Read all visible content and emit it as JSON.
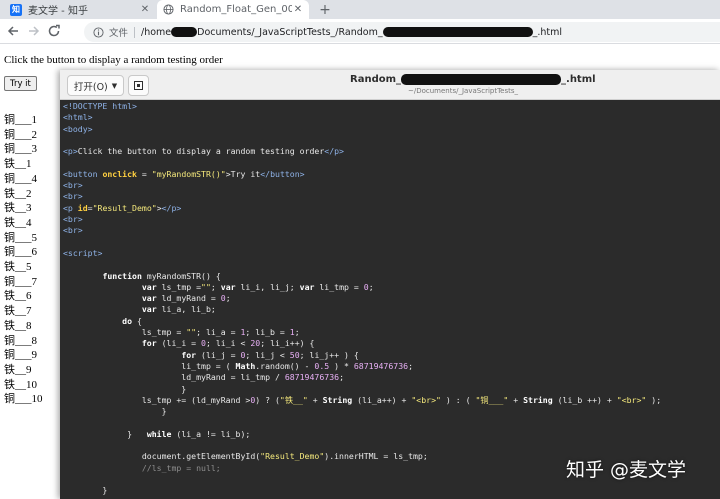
{
  "browser": {
    "tabs": [
      {
        "title": "麦文学 - 知乎",
        "favicon": "zhihu-icon",
        "active": false
      },
      {
        "title": "Random_Float_Gen_000",
        "favicon": "globe-icon",
        "active": true
      }
    ],
    "new_tab_label": "+",
    "nav": {
      "back": "back-arrow-icon",
      "forward": "forward-arrow-icon",
      "reload": "reload-icon"
    },
    "address": {
      "scheme_label": "文件",
      "url_part1": "/home",
      "url_part2": "Documents/_JavaScriptTests_/Random_",
      "url_part3": "_.html"
    }
  },
  "page": {
    "instruction": "Click the button to display a random testing order",
    "button_label": "Try it",
    "results": [
      "铜___1",
      "铜___2",
      "铜___3",
      "铁__1",
      "铜___4",
      "铁__2",
      "铁__3",
      "铁__4",
      "铜___5",
      "铜___6",
      "铁__5",
      "铜___7",
      "铁__6",
      "铁__7",
      "铁__8",
      "铜___8",
      "铜___9",
      "铁__9",
      "铁__10",
      "铜___10"
    ]
  },
  "editor": {
    "open_button": "打开(O)",
    "title_prefix": "Random_",
    "title_suffix": "_.html",
    "subtitle": "~/Documents/_JavaScriptTests_"
  },
  "code_lines": [
    "<!DOCTYPE html>",
    "<html>",
    "<body>",
    "",
    "<p>Click the button to display a random testing order</p>",
    "",
    "<button onclick = \"myRandomSTR()\">Try it</button>",
    "<br>",
    "<br>",
    "<p id=\"Result_Demo\"></p>",
    "<br>",
    "<br>",
    "",
    "<script>",
    "",
    "        function myRandomSTR() {",
    "                var ls_tmp =\"\"; var li_i, li_j; var li_tmp = 0;",
    "                var ld_myRand = 0;",
    "                var li_a, li_b;",
    "            do {",
    "                ls_tmp = \"\"; li_a = 1; li_b = 1;",
    "                for (li_i = 0; li_i < 20; li_i++) {",
    "                        for (li_j = 0; li_j < 50; li_j++ ) {",
    "                        li_tmp = ( Math.random() - 0.5 ) * 68719476736;",
    "                        ld_myRand = li_tmp / 68719476736;",
    "                        }",
    "                ls_tmp += (ld_myRand >0) ? (\"铁__\" + String (li_a++) + \"<br>\" ) : ( \"铜___\" + String (li_b ++) + \"<br>\" );",
    "                    }",
    "",
    "             }   while (li_a != li_b);",
    "",
    "                document.getElementById(\"Result_Demo\").innerHTML = ls_tmp;",
    "                //ls_tmp = null;",
    "",
    "        }"
  ],
  "watermark": "知乎 @麦文学",
  "colors": {
    "tabbar": "#dee1e6",
    "editor_bg": "#2b2b2b",
    "tag": "#8fb3e8",
    "string": "#f5e97c"
  }
}
